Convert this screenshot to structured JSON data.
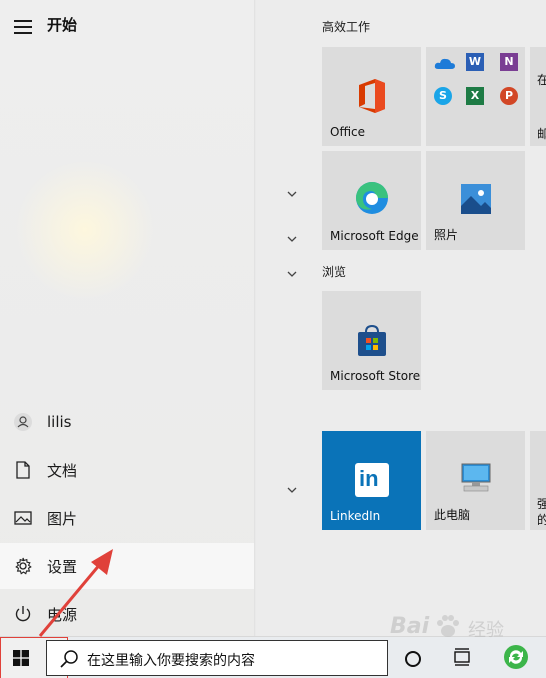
{
  "start_menu": {
    "title": "开始",
    "left_items": [
      {
        "label": "lilis",
        "icon": "user-icon"
      },
      {
        "label": "文档",
        "icon": "document-icon"
      },
      {
        "label": "图片",
        "icon": "picture-icon"
      },
      {
        "label": "设置",
        "icon": "gear-icon"
      },
      {
        "label": "电源",
        "icon": "power-icon"
      }
    ],
    "groups": {
      "productivity": "高效工作",
      "browse": "浏览"
    },
    "tiles": {
      "office": "Office",
      "edge": "Microsoft Edge",
      "photos": "照片",
      "store": "Microsoft Store",
      "linkedin": "LinkedIn",
      "this_pc": "此电脑"
    },
    "partial_tiles": {
      "top_right_1": "在",
      "top_right_2": "邮",
      "bottom_right_1": "强",
      "bottom_right_2": "的"
    }
  },
  "taskbar": {
    "search_placeholder": "在这里输入你要搜索的内容"
  },
  "watermark": {
    "text": "Bai",
    "text2": "经验"
  },
  "colors": {
    "linkedin_tile": "#0a73b8",
    "annotation_red": "#e0413a",
    "office_red": "#d83b01"
  }
}
